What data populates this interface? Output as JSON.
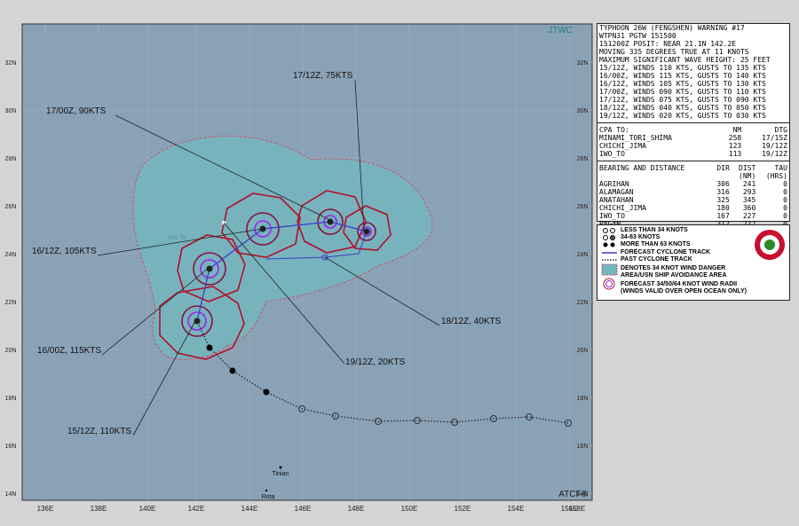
{
  "map": {
    "agency_top": "JTWC",
    "agency_bottom": "ATCF®",
    "lon_ticks": [
      "136E",
      "138E",
      "140E",
      "142E",
      "144E",
      "146E",
      "148E",
      "150E",
      "152E",
      "154E",
      "156E",
      "158E"
    ],
    "lat_ticks": [
      "32N",
      "30N",
      "28N",
      "26N",
      "24N",
      "22N",
      "20N",
      "18N",
      "16N",
      "14N"
    ],
    "place_labels": [
      "Iwo To",
      "Tinian",
      "Rota"
    ],
    "forecast_labels": [
      "17/12Z, 75KTS",
      "17/00Z, 90KTS",
      "16/12Z, 105KTS",
      "16/00Z, 115KTS",
      "15/12Z, 110KTS",
      "18/12Z, 40KTS",
      "19/12Z, 20KTS"
    ],
    "colors": {
      "ocean": "#8aa2b5",
      "danger_area": "#6fb8c0",
      "wind_radii": "#b0102a",
      "inner_radii": "#a020f0",
      "forecast_track": "#3c3cc8"
    }
  },
  "warning": {
    "header": [
      "TYPHOON 26W (FENGSHEN) WARNING #17",
      "WTPN31 PGTW 151500",
      "151200Z POSIT: NEAR 21.1N 142.2E",
      "MOVING 335 DEGREES TRUE AT 11 KNOTS",
      "MAXIMUM SIGNIFICANT WAVE HEIGHT: 25 FEET",
      "15/12Z, WINDS 110 KTS, GUSTS TO 135 KTS",
      "16/00Z, WINDS 115 KTS, GUSTS TO 140 KTS",
      "16/12Z, WINDS 105 KTS, GUSTS TO 130 KTS",
      "17/00Z, WINDS 090 KTS, GUSTS TO 110 KTS",
      "17/12Z, WINDS 075 KTS, GUSTS TO 090 KTS",
      "18/12Z, WINDS 040 KTS, GUSTS TO 050 KTS",
      "19/12Z, WINDS 020 KTS, GUSTS TO 030 KTS"
    ],
    "cpa": {
      "headers": [
        "CPA TO:",
        "NM",
        "DTG"
      ],
      "rows": [
        [
          "MINAMI_TORI_SHIMA",
          "258",
          "17/15Z"
        ],
        [
          "CHICHI_JIMA",
          "123",
          "19/12Z"
        ],
        [
          "IWO_TO",
          "113",
          "19/12Z"
        ]
      ]
    },
    "bearing": {
      "headers": [
        "BEARING AND DISTANCE",
        "DIR",
        "DIST",
        "TAU"
      ],
      "subheaders": [
        "",
        "",
        "(NM)",
        "(HRS)"
      ],
      "rows": [
        [
          "AGRIHAN",
          "306",
          "241",
          "0"
        ],
        [
          "ALAMAGAN",
          "316",
          "293",
          "0"
        ],
        [
          "ANATAHAN",
          "325",
          "345",
          "0"
        ],
        [
          "CHICHI_JIMA",
          "180",
          "360",
          "0"
        ],
        [
          "IWO_TO",
          "167",
          "227",
          "0"
        ],
        [
          "PAGAN",
          "312",
          "272",
          "0"
        ]
      ]
    }
  },
  "legend": {
    "items": [
      "LESS THAN 34 KNOTS",
      "34-63 KNOTS",
      "MORE THAN 63 KNOTS",
      "FORECAST CYCLONE TRACK",
      "PAST CYCLONE TRACK",
      "DENOTES 34 KNOT WIND DANGER",
      "AREA/USN SHIP AVOIDANCE AREA",
      "FORECAST 34/50/64 KNOT WIND RADII",
      "(WINDS VALID OVER OPEN OCEAN ONLY)"
    ]
  }
}
